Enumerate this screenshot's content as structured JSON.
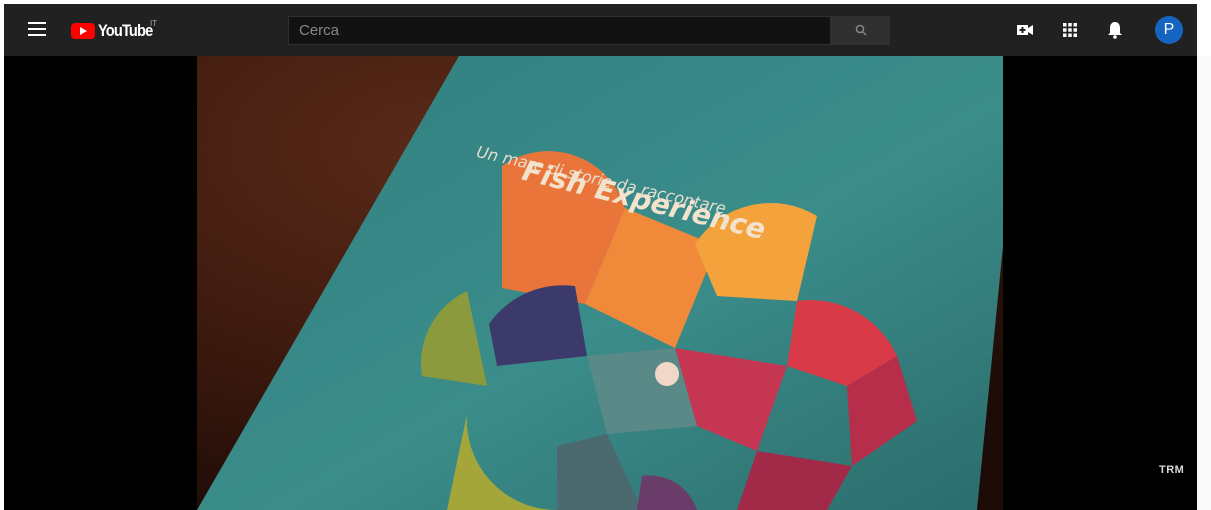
{
  "masthead": {
    "logo_text": "YouTube",
    "country_code": "IT",
    "search_placeholder": "Cerca",
    "avatar_initial": "P"
  },
  "video": {
    "cover_title": "Fish Experience",
    "cover_subtitle": "Un mare di storie da raccontare",
    "watermark": "TRM"
  },
  "colors": {
    "masthead_bg": "#212121",
    "brand_red": "#ff0000",
    "avatar_bg": "#1565c0",
    "brochure_teal": "#3a8a88"
  },
  "icons": [
    "menu-icon",
    "search-icon",
    "create-video-icon",
    "apps-grid-icon",
    "notifications-bell-icon"
  ]
}
